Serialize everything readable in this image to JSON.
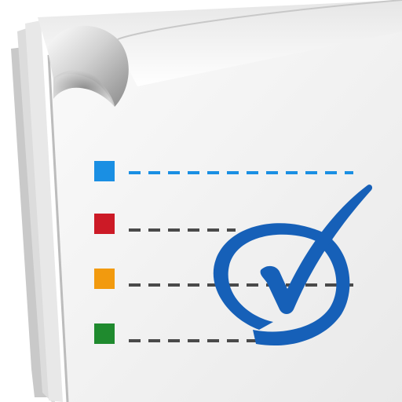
{
  "icon": {
    "subject": "checklist",
    "items": [
      {
        "bullet_color": "#1a8fe3",
        "line_color": "#1a8fe3"
      },
      {
        "bullet_color": "#cc1a26",
        "line_color": "#4a4a4a"
      },
      {
        "bullet_color": "#f29a0e",
        "line_color": "#4a4a4a"
      },
      {
        "bullet_color": "#1f8a2e",
        "line_color": "#4a4a4a"
      }
    ],
    "check": {
      "color": "#1660b8"
    },
    "paper": {
      "color": "#f6f6f6",
      "shadow": "#bdbdbd"
    }
  }
}
